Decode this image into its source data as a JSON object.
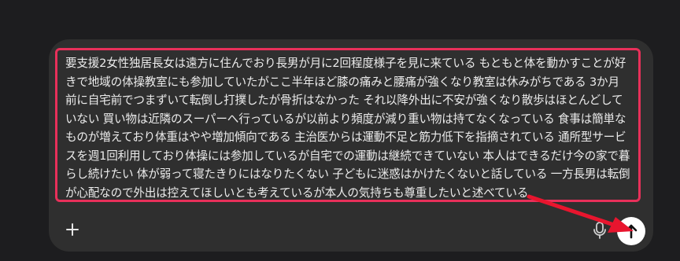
{
  "composer": {
    "message": "要支援2女性独居長女は遠方に住んでおり長男が月に2回程度様子を見に来ている もともと体を動かすことが好きで地域の体操教室にも参加していたがここ半年ほど膝の痛みと腰痛が強くなり教室は休みがちである 3か月前に自宅前でつまずいて転倒し打撲したが骨折はなかった それ以降外出に不安が強くなり散歩はほとんどしていない 買い物は近隣のスーパーへ行っているが以前より頻度が減り重い物は持てなくなっている 食事は簡単なものが増えており体重はやや増加傾向である 主治医からは運動不足と筋力低下を指摘されている 通所型サービスを週1回利用しており体操には参加しているが自宅での運動は継続できていない 本人はできるだけ今の家で暮らし続けたい 体が弱って寝たきりにはなりたくない 子どもに迷惑はかけたくないと話している 一方長男は転倒が心配なので外出は控えてほしいとも考えているが本人の気持ちも尊重したいと述べている"
  },
  "icons": {
    "add": "plus-icon",
    "voice": "microphone-icon",
    "send": "arrow-up-icon",
    "annotation": "red-arrow-annotation"
  },
  "colors": {
    "page_background": "#1d1d1f",
    "composer_background": "#2f2f2f",
    "highlight_border": "#e8305a",
    "annotation_arrow": "#e8152e",
    "send_button": "#ffffff",
    "text": "#ececec"
  }
}
